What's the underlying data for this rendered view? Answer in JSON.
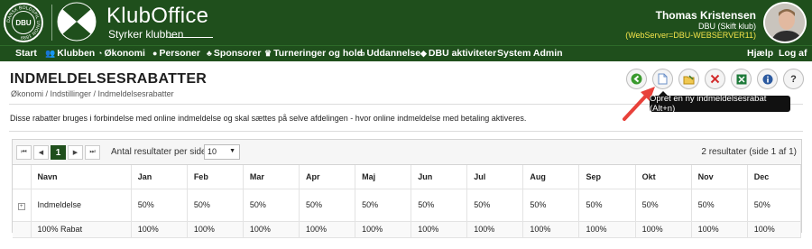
{
  "header": {
    "app_title": "KlubOffice",
    "tagline": "Styrker klubben",
    "crest_initials": "DBU",
    "crest_ring_text": "DANSK BOLDSPIL UNION 1889",
    "user": {
      "name": "Thomas Kristensen",
      "club": "DBU (Skift klub)",
      "server": "(WebServer=DBU-WEBSERVER11)"
    }
  },
  "nav": {
    "items": [
      {
        "label": "Start",
        "icon": ""
      },
      {
        "label": "Klubben",
        "icon": "users-icon"
      },
      {
        "label": "Økonomi",
        "icon": "coin-icon"
      },
      {
        "label": "Personer",
        "icon": "person-icon"
      },
      {
        "label": "Sponsorer",
        "icon": "money-bag-icon"
      },
      {
        "label": "Turneringer og hold",
        "icon": "trophy-icon"
      },
      {
        "label": "Uddannelse",
        "icon": "monitor-icon"
      },
      {
        "label": "DBU aktiviteter",
        "icon": "graduation-cap-icon"
      },
      {
        "label": "System Admin",
        "icon": ""
      }
    ],
    "help": "Hjælp",
    "logout": "Log af"
  },
  "page": {
    "title": "INDMELDELSESRABATTER",
    "breadcrumb": "Økonomi / Indstillinger / Indmeldelsesrabatter",
    "description": "Disse rabatter bruges i forbindelse med online indmeldelse og skal sættes på selve afdelingen - hvor online indmeldelse med betaling aktiveres."
  },
  "toolbar": {
    "tooltip": "Opret en ny indmeldelsesrabat (Alt+n)",
    "buttons": [
      {
        "name": "back-button",
        "icon": "arrow-left-icon",
        "color": "#3a9a2e"
      },
      {
        "name": "new-button",
        "icon": "document-icon",
        "color": "#6a8fc7"
      },
      {
        "name": "edit-button",
        "icon": "folder-edit-icon",
        "color": "#d9a21b"
      },
      {
        "name": "delete-button",
        "icon": "x-icon",
        "color": "#d22b2b"
      },
      {
        "name": "export-excel-button",
        "icon": "excel-icon",
        "color": "#1e7a3a"
      },
      {
        "name": "info-button",
        "icon": "info-icon",
        "color": "#2c5aa0"
      },
      {
        "name": "help-button",
        "icon": "question-icon",
        "color": "#333333"
      }
    ]
  },
  "grid": {
    "pager": {
      "first": "⏮",
      "prev": "◀",
      "current_page": "1",
      "next": "▶",
      "last": "⏭"
    },
    "per_page_label": "Antal resultater per side",
    "per_page_value": "10",
    "result_count": "2 resultater (side 1 af 1)",
    "columns": [
      "Navn",
      "Jan",
      "Feb",
      "Mar",
      "Apr",
      "Maj",
      "Jun",
      "Jul",
      "Aug",
      "Sep",
      "Okt",
      "Nov",
      "Dec"
    ],
    "rows": [
      {
        "expandable": true,
        "cells": [
          "Indmeldelse",
          "50%",
          "50%",
          "50%",
          "50%",
          "50%",
          "50%",
          "50%",
          "50%",
          "50%",
          "50%",
          "50%",
          "50%"
        ]
      },
      {
        "expandable": false,
        "cells": [
          "100% Rabat",
          "100%",
          "100%",
          "100%",
          "100%",
          "100%",
          "100%",
          "100%",
          "100%",
          "100%",
          "100%",
          "100%",
          "100%"
        ]
      }
    ]
  },
  "colors": {
    "brand_green": "#1f4f1c",
    "server_text": "#f3e34a",
    "annotation_arrow": "#e8413a"
  }
}
